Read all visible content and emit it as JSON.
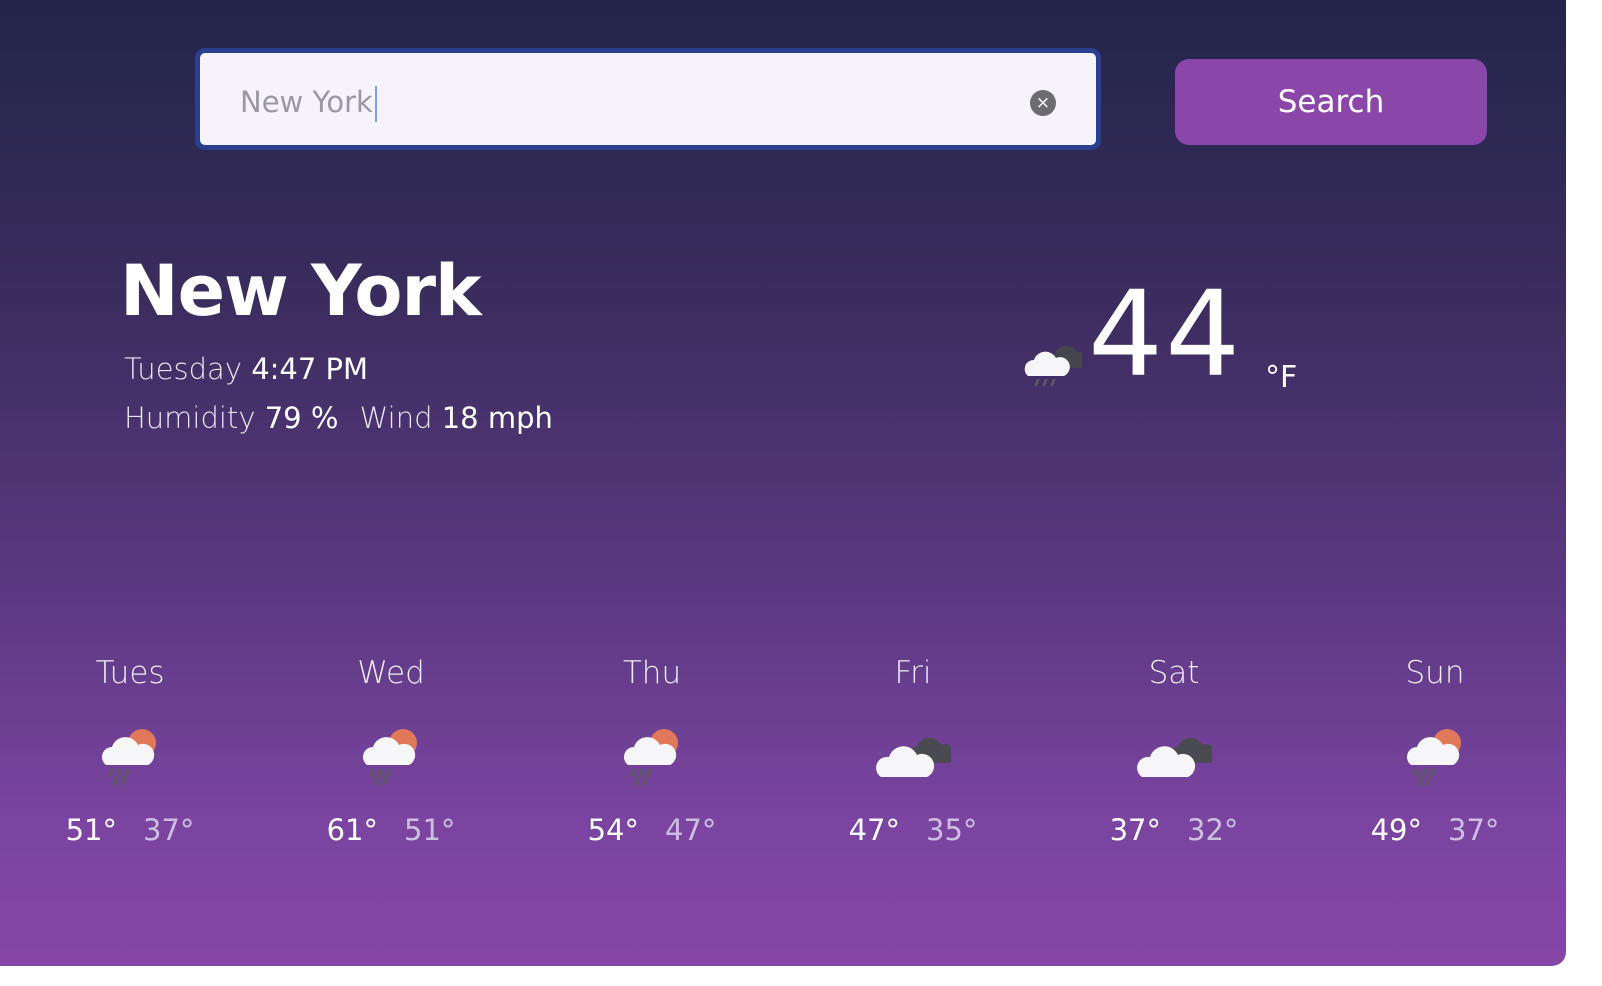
{
  "search": {
    "value": "New York",
    "button_label": "Search",
    "clear_symbol": "×"
  },
  "current": {
    "city": "New York",
    "day": "Tuesday",
    "time": "4:47 PM",
    "humidity_label": "Humidity",
    "humidity_value": "79 %",
    "wind_label": "Wind",
    "wind_value": "18 mph",
    "temperature": "44",
    "unit": "°F",
    "icon": "cloud-rain-icon"
  },
  "forecast": [
    {
      "day": "Tues",
      "high": "51°",
      "low": "37°",
      "icon": "sun-cloud-rain-icon"
    },
    {
      "day": "Wed",
      "high": "61°",
      "low": "51°",
      "icon": "sun-cloud-rain-icon"
    },
    {
      "day": "Thu",
      "high": "54°",
      "low": "47°",
      "icon": "sun-cloud-rain-icon"
    },
    {
      "day": "Fri",
      "high": "47°",
      "low": "35°",
      "icon": "cloudy-icon"
    },
    {
      "day": "Sat",
      "high": "37°",
      "low": "32°",
      "icon": "cloudy-icon"
    },
    {
      "day": "Sun",
      "high": "49°",
      "low": "37°",
      "icon": "sun-cloud-rain-icon"
    }
  ],
  "colors": {
    "button": "#8a47a9",
    "input_border": "#2c3f8f",
    "sun": "#e0785a"
  }
}
